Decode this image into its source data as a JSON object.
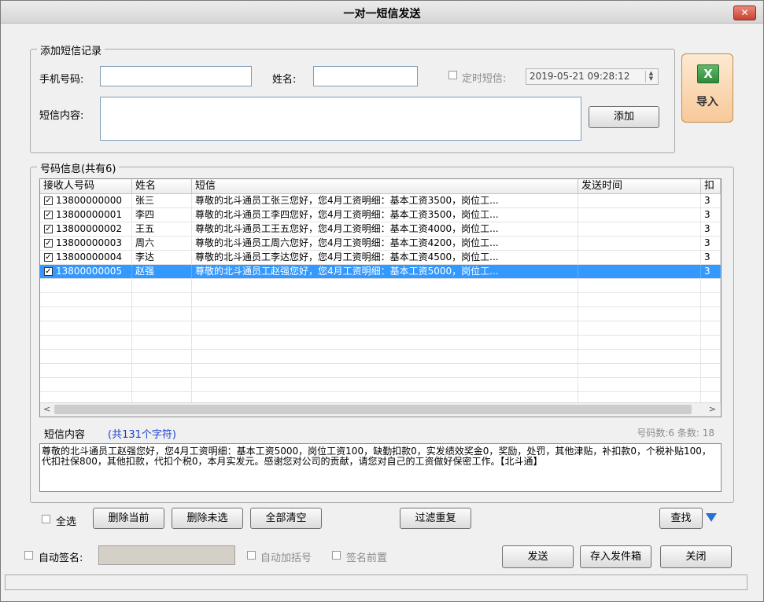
{
  "window": {
    "title": "一对一短信发送",
    "close_glyph": "✕"
  },
  "add_group": {
    "legend": "添加短信记录",
    "phone_label": "手机号码:",
    "phone_value": "",
    "name_label": "姓名:",
    "name_value": "",
    "schedule_label": "定时短信:",
    "schedule_value": "2019-05-21 09:28:12",
    "content_label": "短信内容:",
    "content_value": "",
    "add_button": "添加"
  },
  "import_button": {
    "label": "导入",
    "icon": "excel-icon"
  },
  "numbers_group": {
    "legend": "号码信息(共有6)",
    "columns": [
      "接收人号码",
      "姓名",
      "短信",
      "发送时间",
      "扣"
    ],
    "rows": [
      {
        "phone": "13800000000",
        "name": "张三",
        "sms": "尊敬的北斗通员工张三您好，您4月工资明细：基本工资3500，岗位工...",
        "time": "",
        "deduct": "3",
        "checked": true,
        "selected": false
      },
      {
        "phone": "13800000001",
        "name": "李四",
        "sms": "尊敬的北斗通员工李四您好，您4月工资明细：基本工资3500，岗位工...",
        "time": "",
        "deduct": "3",
        "checked": true,
        "selected": false
      },
      {
        "phone": "13800000002",
        "name": "王五",
        "sms": "尊敬的北斗通员工王五您好，您4月工资明细：基本工资4000，岗位工...",
        "time": "",
        "deduct": "3",
        "checked": true,
        "selected": false
      },
      {
        "phone": "13800000003",
        "name": "周六",
        "sms": "尊敬的北斗通员工周六您好，您4月工资明细：基本工资4200，岗位工...",
        "time": "",
        "deduct": "3",
        "checked": true,
        "selected": false
      },
      {
        "phone": "13800000004",
        "name": "李达",
        "sms": "尊敬的北斗通员工李达您好，您4月工资明细：基本工资4500，岗位工...",
        "time": "",
        "deduct": "3",
        "checked": true,
        "selected": false
      },
      {
        "phone": "13800000005",
        "name": "赵强",
        "sms": "尊敬的北斗通员工赵强您好，您4月工资明细：基本工资5000，岗位工...",
        "time": "",
        "deduct": "3",
        "checked": true,
        "selected": true
      }
    ],
    "content_label": "短信内容",
    "char_count": "(共131个字符)",
    "stats": "号码数:6 条数: 18",
    "content_text": "尊敬的北斗通员工赵强您好，您4月工资明细：基本工资5000，岗位工资100，缺勤扣款0，实发绩效奖金0，奖励，处罚，其他津贴，补扣款0，个税补贴100，代扣社保800，其他扣款，代扣个税0，本月实发元。感谢您对公司的贡献，请您对自己的工资做好保密工作。【北斗通】",
    "select_all": "全选",
    "delete_current": "删除当前",
    "delete_unselected": "删除未选",
    "clear_all": "全部清空",
    "filter_dup": "过滤重复",
    "find": "查找"
  },
  "bottom": {
    "auto_sign": "自动签名:",
    "auto_sign_value": "",
    "auto_bracket": "自动加括号",
    "sign_prefix": "签名前置",
    "send": "发送",
    "save_outbox": "存入发件箱",
    "close": "关闭"
  },
  "scroll": {
    "left": "<",
    "right": ">"
  }
}
